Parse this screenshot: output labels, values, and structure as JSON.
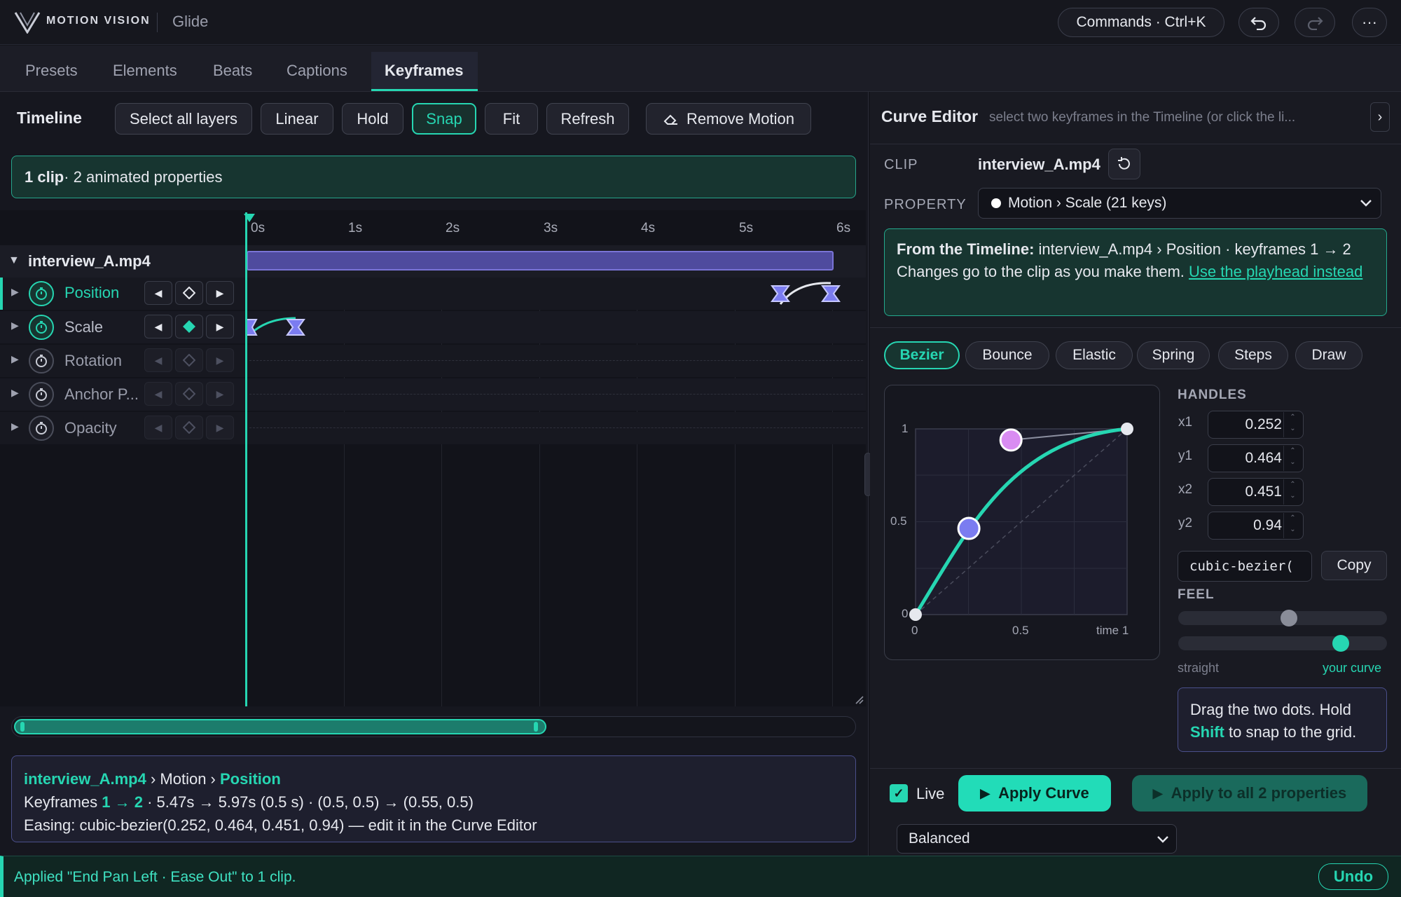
{
  "header": {
    "brand": "MOTION VISION",
    "app_name": "Glide",
    "commands_label": "Commands · Ctrl+K",
    "more_label": "···"
  },
  "tabs": [
    "Presets",
    "Elements",
    "Beats",
    "Captions",
    "Keyframes"
  ],
  "timeline": {
    "title": "Timeline",
    "buttons": [
      "Select all layers",
      "Linear",
      "Hold",
      "Snap",
      "Fit",
      "Refresh"
    ],
    "remove_motion": "Remove Motion",
    "selection_bold": "1 clip",
    "selection_rest": " · 2 animated properties",
    "ticks": [
      "0s",
      "1s",
      "2s",
      "3s",
      "4s",
      "5s",
      "6s"
    ],
    "clip_name": "interview_A.mp4",
    "properties": [
      "Position",
      "Scale",
      "Rotation",
      "Anchor P...",
      "Opacity"
    ]
  },
  "info": {
    "clip": "interview_A.mp4",
    "path_mid": " › Motion › ",
    "property": "Position",
    "line2_pre": "Keyframes ",
    "line2_keys": "1 → 2",
    "line2_rest": " · 5.47s → 5.97s (0.5 s) · (0.5, 0.5) → (0.55, 0.5)",
    "line3": "Easing: cubic-bezier(0.252, 0.464, 0.451, 0.94) — edit it in the Curve Editor"
  },
  "status": {
    "message": "Applied \"End Pan Left · Ease Out\" to 1 clip.",
    "undo": "Undo"
  },
  "curve_editor": {
    "title": "Curve Editor",
    "subtitle": "select two keyframes in the Timeline (or click the li...",
    "clip_label": "CLIP",
    "clip_value": "interview_A.mp4",
    "property_label": "PROPERTY",
    "property_value": "Motion › Scale (21 keys)",
    "from_bold": "From the Timeline:",
    "from_rest": " interview_A.mp4 › Position · keyframes 1 → 2",
    "from_line2": "Changes go to the clip as you make them. ",
    "from_link": "Use the playhead instead",
    "easing_tabs": [
      "Bezier",
      "Bounce",
      "Elastic",
      "Spring",
      "Steps",
      "Draw"
    ],
    "graph": {
      "y_ticks": [
        "1",
        "0.5",
        "0"
      ],
      "x_ticks": [
        "0",
        "0.5",
        "time 1"
      ]
    },
    "handles_label": "HANDLES",
    "handles": [
      {
        "name": "x1",
        "value": "0.252"
      },
      {
        "name": "y1",
        "value": "0.464"
      },
      {
        "name": "x2",
        "value": "0.451"
      },
      {
        "name": "y2",
        "value": "0.94"
      }
    ],
    "code": "cubic-bezier(",
    "copy": "Copy",
    "feel_label": "FEEL",
    "feel_left": "straight",
    "feel_right": "your curve",
    "hint_pre": "Drag the two dots. Hold ",
    "hint_key": "Shift",
    "hint_post": " to snap to the grid.",
    "live": "Live",
    "apply": "Apply Curve",
    "apply_all": "Apply to all 2 properties",
    "preset": "Balanced"
  },
  "colors": {
    "accent": "#26d6b2",
    "handle1": "#7b7cf0",
    "handle2": "#d98cf2",
    "clip_bar": "#4f4b9e"
  }
}
